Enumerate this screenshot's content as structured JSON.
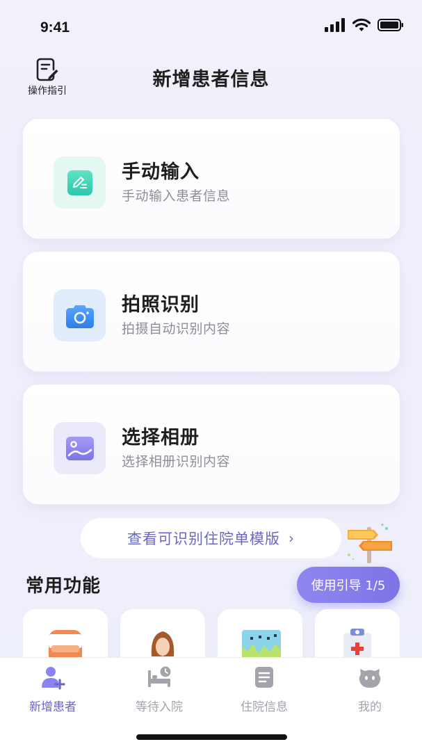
{
  "status_bar": {
    "time": "9:41",
    "signal_icon": "cellular-signal-icon",
    "wifi_icon": "wifi-icon",
    "battery_icon": "battery-icon"
  },
  "header": {
    "title": "新增患者信息",
    "guide_label": "操作指引",
    "guide_icon": "document-edit-icon"
  },
  "options": [
    {
      "title": "手动输入",
      "subtitle": "手动输入患者信息",
      "icon": "pencil-edit-icon",
      "accent": "#34d3b6"
    },
    {
      "title": "拍照识别",
      "subtitle": "拍摄自动识别内容",
      "icon": "camera-icon",
      "accent": "#3f8cf5"
    },
    {
      "title": "选择相册",
      "subtitle": "选择相册识别内容",
      "icon": "image-gallery-icon",
      "accent": "#8a84ee"
    }
  ],
  "template_link": {
    "label": "查看可识别住院单模版",
    "chevron": "›"
  },
  "common": {
    "title": "常用功能",
    "guide_pill": "使用引导 1/5",
    "tiles": [
      "medicine-bottle-icon",
      "doctor-avatar-icon",
      "chart-monitor-icon",
      "medical-clipboard-icon"
    ]
  },
  "tab_bar": {
    "tabs": [
      {
        "label": "新增患者",
        "icon": "add-patient-icon",
        "active": true
      },
      {
        "label": "等待入院",
        "icon": "hospital-bed-icon",
        "active": false
      },
      {
        "label": "住院信息",
        "icon": "document-list-icon",
        "active": false
      },
      {
        "label": "我的",
        "icon": "profile-face-icon",
        "active": false
      }
    ]
  },
  "colors": {
    "accent": "#6b66c9",
    "pill": "#857cec",
    "inactive": "#a3a3ab"
  }
}
